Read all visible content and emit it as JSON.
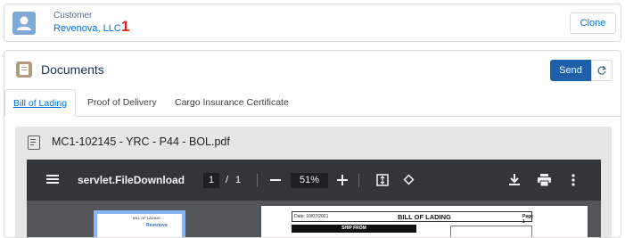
{
  "customer": {
    "label": "Customer",
    "name": "Revenova, LLC",
    "badge": "1",
    "clone_label": "Clone"
  },
  "documents": {
    "title": "Documents",
    "send_label": "Send",
    "tabs": [
      {
        "label": "Bill of Lading",
        "active": true
      },
      {
        "label": "Proof of Delivery",
        "active": false
      },
      {
        "label": "Cargo Insurance Certificate",
        "active": false
      }
    ]
  },
  "viewer": {
    "file_title": "MC1-102145 - YRC - P44 - BOL.pdf",
    "toolbar": {
      "doc_name": "servlet.FileDownload",
      "current_page": "1",
      "page_separator": "/",
      "total_pages": "1",
      "zoom": "51%"
    },
    "page": {
      "date": "Date: 10/07/2021",
      "title": "BILL OF LADING",
      "page_label": "Page 1",
      "ship_from": "SHIP FROM"
    },
    "thumbnail": {
      "title": "BILL OF LADING",
      "brand": "Revenova"
    }
  },
  "colors": {
    "accent": "#0070d2",
    "send_button": "#1f5ea8",
    "badge_red": "#e3201b",
    "toolbar_bg": "#323639"
  },
  "icons": [
    "contact-avatar-icon",
    "document-icon",
    "refresh-icon",
    "file-edit-icon",
    "menu-icon",
    "zoom-out-icon",
    "zoom-in-icon",
    "fit-page-icon",
    "rotate-icon",
    "download-icon",
    "print-icon",
    "more-vert-icon"
  ]
}
